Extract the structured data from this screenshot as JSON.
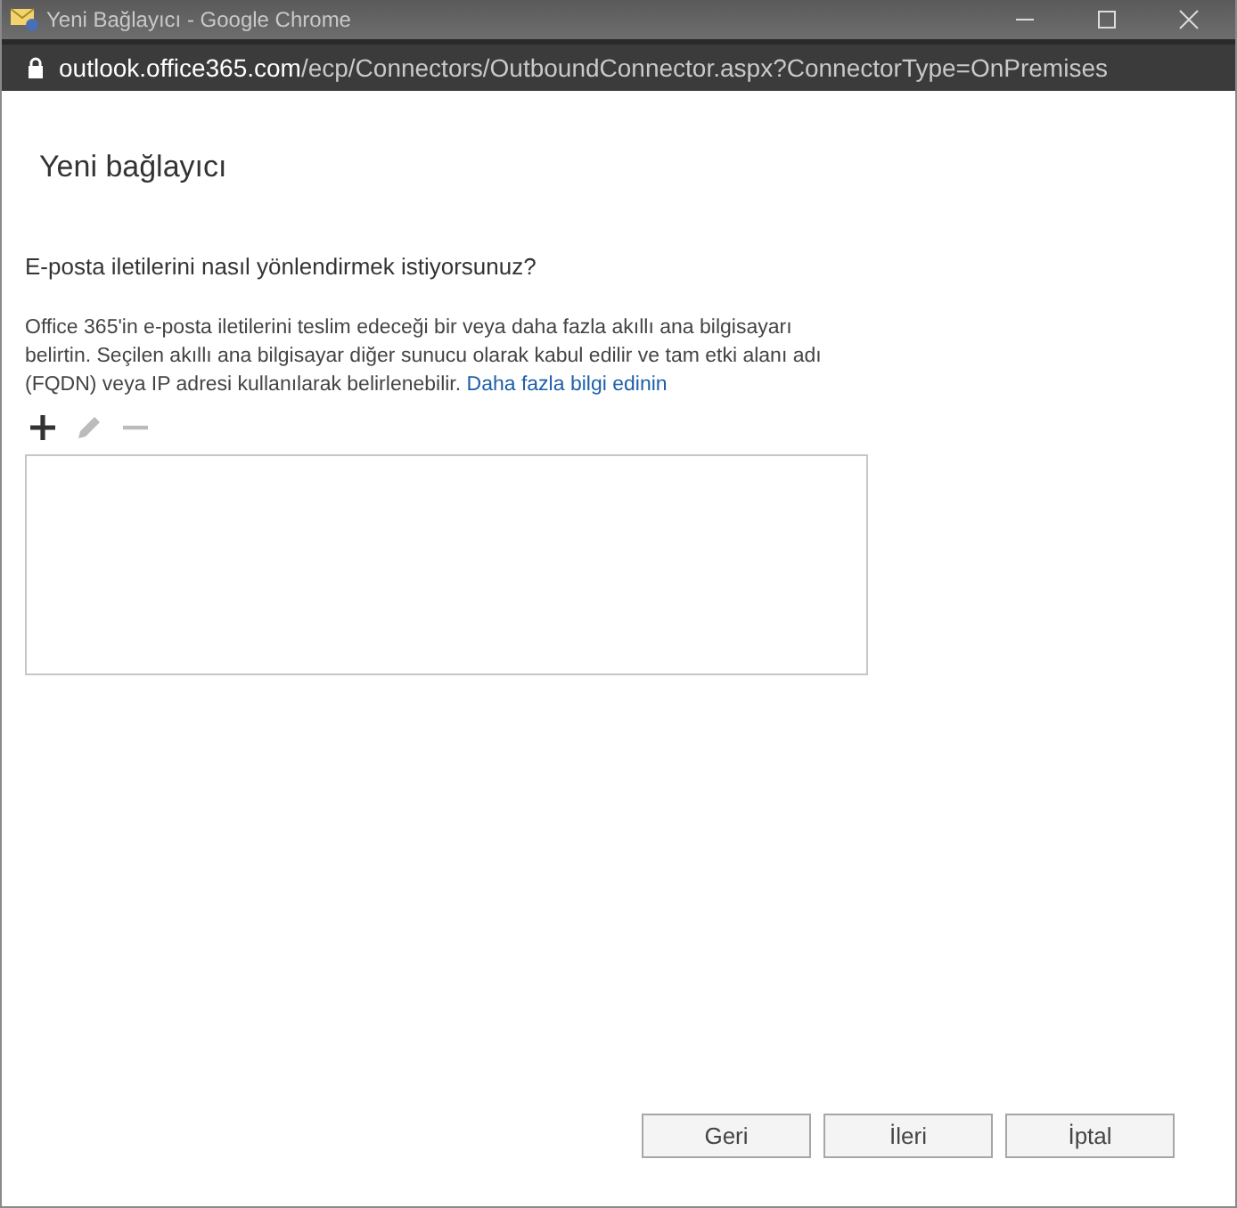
{
  "window": {
    "title": "Yeni Bağlayıcı - Google Chrome"
  },
  "address_bar": {
    "host": "outlook.office365.com",
    "path": "/ecp/Connectors/OutboundConnector.aspx?ConnectorType=OnPremises"
  },
  "page_title": "Yeni bağlayıcı",
  "question": "E-posta iletilerini nasıl yönlendirmek istiyorsunuz?",
  "description": "Office 365'in e-posta iletilerini teslim edeceği bir veya daha fazla akıllı ana bilgisayarı belirtin. Seçilen akıllı ana bilgisayar diğer sunucu olarak kabul edilir ve tam etki alanı adı (FQDN) veya IP adresi kullanılarak belirlenebilir.",
  "learn_more_link": "Daha fazla bilgi edinin",
  "tools": [
    {
      "kind": "add",
      "disabled": false
    },
    {
      "kind": "edit",
      "disabled": true
    },
    {
      "kind": "remove",
      "disabled": true
    }
  ],
  "buttons": [
    "Geri",
    "İleri",
    "İptal"
  ]
}
